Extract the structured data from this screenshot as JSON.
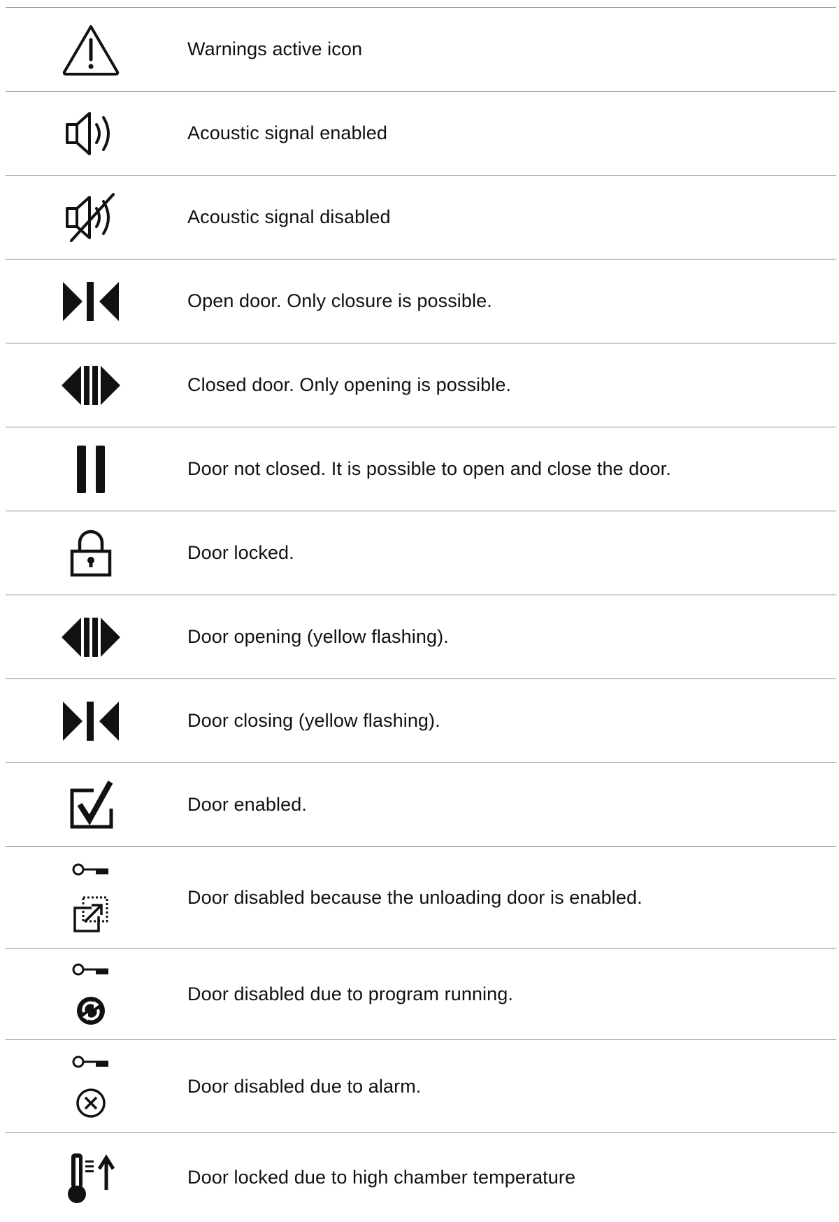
{
  "rows": [
    {
      "icon": "warning-triangle-icon",
      "text": "Warnings active icon"
    },
    {
      "icon": "speaker-on-icon",
      "text": "Acoustic signal enabled"
    },
    {
      "icon": "speaker-muted-icon",
      "text": "Acoustic signal disabled"
    },
    {
      "icon": "door-close-icon",
      "text": "Open door. Only closure is possible."
    },
    {
      "icon": "door-open-icon",
      "text": "Closed door. Only opening is possible."
    },
    {
      "icon": "door-bars-icon",
      "text": "Door not closed. It is possible to open and close the door."
    },
    {
      "icon": "padlock-icon",
      "text": "Door locked."
    },
    {
      "icon": "door-open-icon",
      "text": "Door opening (yellow flashing)."
    },
    {
      "icon": "door-close-icon",
      "text": "Door closing (yellow flashing)."
    },
    {
      "icon": "checkbox-checked-icon",
      "text": "Door enabled."
    },
    {
      "icon": [
        "key-icon",
        "unloading-door-icon"
      ],
      "text": "Door disabled because the unloading door is enabled."
    },
    {
      "icon": [
        "key-icon",
        "program-running-icon"
      ],
      "text": "Door disabled due to program running."
    },
    {
      "icon": [
        "key-icon",
        "alarm-x-circle-icon"
      ],
      "text": "Door disabled due to alarm."
    },
    {
      "icon": [
        "thermometer-high-icon"
      ],
      "text": "Door locked due to high chamber temperature"
    }
  ]
}
